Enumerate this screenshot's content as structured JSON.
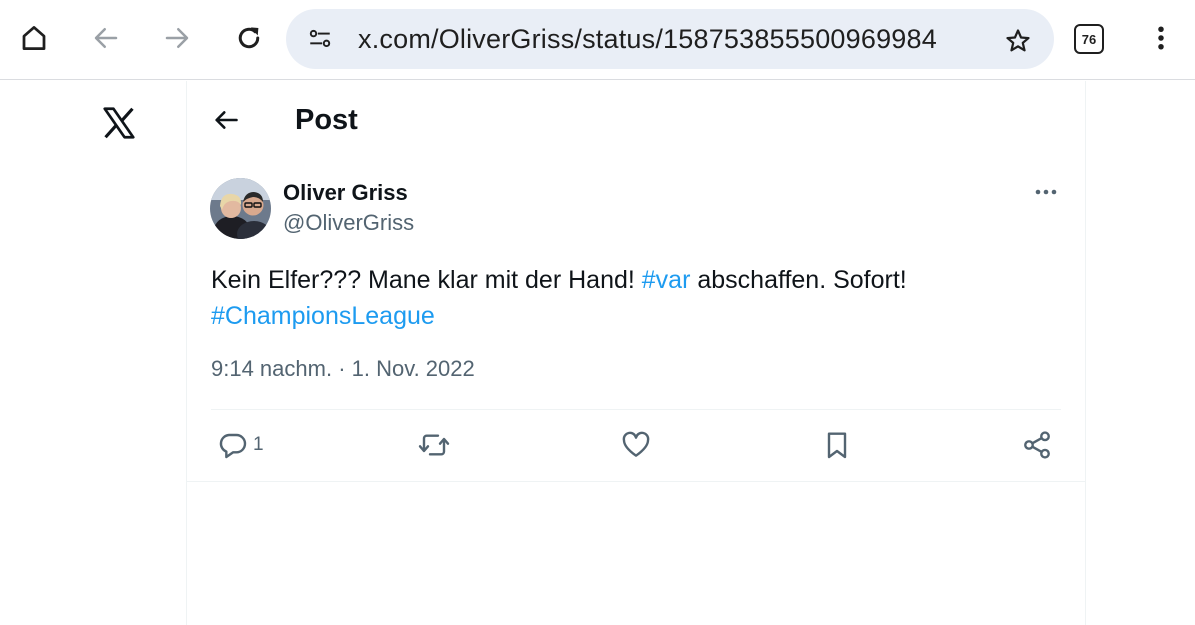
{
  "browser": {
    "url": "x.com/OliverGriss/status/158753855500969984",
    "tab_count": "76",
    "icons": {
      "home": "home-icon",
      "back": "back-arrow-icon",
      "forward": "forward-arrow-icon",
      "reload": "reload-icon",
      "site_settings": "site-settings-icon",
      "bookmark": "star-icon",
      "menu": "kebab-menu-icon"
    }
  },
  "header": {
    "title": "Post"
  },
  "post": {
    "author_name": "Oliver Griss",
    "author_handle": "@OliverGriss",
    "text_part1": "Kein Elfer??? Mane klar mit der Hand! ",
    "hashtag1": "#var",
    "text_part2": " abschaffen. Sofort!",
    "hashtag2": "#ChampionsLeague",
    "timestamp": "9:14 nachm. · 1. Nov. 2022",
    "reply_count": "1"
  },
  "colors": {
    "accent": "#1d9bf0",
    "secondary_text": "#536471",
    "primary_text": "#0f1419",
    "omnibox_bg": "#e9eef6"
  }
}
